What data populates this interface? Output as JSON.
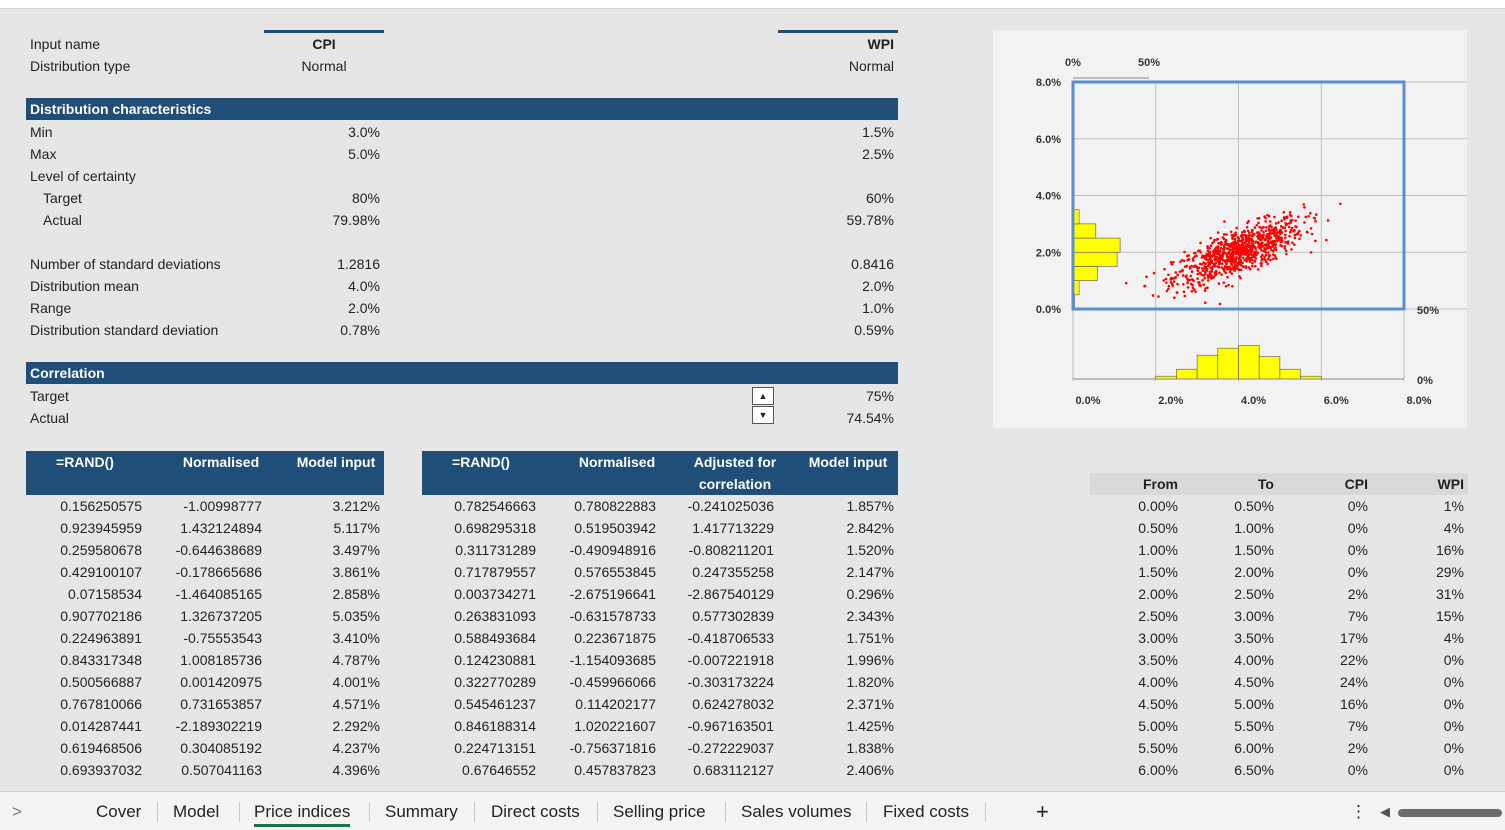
{
  "inputs": {
    "name_label": "Input name",
    "dist_type_label": "Distribution type",
    "cpi_name": "CPI",
    "wpi_name": "WPI",
    "cpi_type": "Normal",
    "wpi_type": "Normal"
  },
  "dist": {
    "header": "Distribution characteristics",
    "min_label": "Min",
    "max_label": "Max",
    "certainty_label": "Level of certainty",
    "target_label": "Target",
    "actual_label": "Actual",
    "cpi_min": "3.0%",
    "cpi_max": "5.0%",
    "cpi_target": "80%",
    "cpi_actual": "79.98%",
    "wpi_min": "1.5%",
    "wpi_max": "2.5%",
    "wpi_target": "60%",
    "wpi_actual": "59.78%",
    "nsd_label": "Number of standard deviations",
    "mean_label": "Distribution mean",
    "range_label": "Range",
    "sd_label": "Distribution standard deviation",
    "cpi_nsd": "1.2816",
    "cpi_mean": "4.0%",
    "cpi_range": "2.0%",
    "cpi_sd": "0.78%",
    "wpi_nsd": "0.8416",
    "wpi_mean": "2.0%",
    "wpi_range": "1.0%",
    "wpi_sd": "0.59%"
  },
  "correlation": {
    "header": "Correlation",
    "target_label": "Target",
    "actual_label": "Actual",
    "target": "75%",
    "actual": "74.54%",
    "spin_up": "▲",
    "spin_down": "▼"
  },
  "cpi_table": {
    "headers": [
      "=RAND()",
      "Normalised",
      "Model input"
    ],
    "rows": [
      [
        "0.156250575",
        "-1.00998777",
        "3.212%"
      ],
      [
        "0.923945959",
        "1.432124894",
        "5.117%"
      ],
      [
        "0.259580678",
        "-0.644638689",
        "3.497%"
      ],
      [
        "0.429100107",
        "-0.178665686",
        "3.861%"
      ],
      [
        "0.07158534",
        "-1.464085165",
        "2.858%"
      ],
      [
        "0.907702186",
        "1.326737205",
        "5.035%"
      ],
      [
        "0.224963891",
        "-0.75553543",
        "3.410%"
      ],
      [
        "0.843317348",
        "1.008185736",
        "4.787%"
      ],
      [
        "0.500566887",
        "0.001420975",
        "4.001%"
      ],
      [
        "0.767810066",
        "0.731653857",
        "4.571%"
      ],
      [
        "0.014287441",
        "-2.189302219",
        "2.292%"
      ],
      [
        "0.619468506",
        "0.304085192",
        "4.237%"
      ],
      [
        "0.693937032",
        "0.507041163",
        "4.396%"
      ]
    ]
  },
  "wpi_table": {
    "headers": [
      "=RAND()",
      "Normalised",
      "Adjusted for",
      "correlation",
      "Model input"
    ],
    "rows": [
      [
        "0.782546663",
        "0.780822883",
        "-0.241025036",
        "1.857%"
      ],
      [
        "0.698295318",
        "0.519503942",
        "1.417713229",
        "2.842%"
      ],
      [
        "0.311731289",
        "-0.490948916",
        "-0.808211201",
        "1.520%"
      ],
      [
        "0.717879557",
        "0.576553845",
        "0.247355258",
        "2.147%"
      ],
      [
        "0.003734271",
        "-2.675196641",
        "-2.867540129",
        "0.296%"
      ],
      [
        "0.263831093",
        "-0.631578733",
        "0.577302839",
        "2.343%"
      ],
      [
        "0.588493684",
        "0.223671875",
        "-0.418706533",
        "1.751%"
      ],
      [
        "0.124230881",
        "-1.154093685",
        "-0.007221918",
        "1.996%"
      ],
      [
        "0.322770289",
        "-0.459966066",
        "-0.303173224",
        "1.820%"
      ],
      [
        "0.545461237",
        "0.114202177",
        "0.624278032",
        "2.371%"
      ],
      [
        "0.846188314",
        "1.020221607",
        "-0.967163501",
        "1.425%"
      ],
      [
        "0.224713151",
        "-0.756371816",
        "-0.272229037",
        "1.838%"
      ],
      [
        "0.67646552",
        "0.457837823",
        "0.683112127",
        "2.406%"
      ]
    ]
  },
  "freq_table": {
    "headers": [
      "From",
      "To",
      "CPI",
      "WPI"
    ],
    "rows": [
      [
        "0.00%",
        "0.50%",
        "0%",
        "1%"
      ],
      [
        "0.50%",
        "1.00%",
        "0%",
        "4%"
      ],
      [
        "1.00%",
        "1.50%",
        "0%",
        "16%"
      ],
      [
        "1.50%",
        "2.00%",
        "0%",
        "29%"
      ],
      [
        "2.00%",
        "2.50%",
        "2%",
        "31%"
      ],
      [
        "2.50%",
        "3.00%",
        "7%",
        "15%"
      ],
      [
        "3.00%",
        "3.50%",
        "17%",
        "4%"
      ],
      [
        "3.50%",
        "4.00%",
        "22%",
        "0%"
      ],
      [
        "4.00%",
        "4.50%",
        "24%",
        "0%"
      ],
      [
        "4.50%",
        "5.00%",
        "16%",
        "0%"
      ],
      [
        "5.00%",
        "5.50%",
        "7%",
        "0%"
      ],
      [
        "5.50%",
        "6.00%",
        "2%",
        "0%"
      ],
      [
        "6.00%",
        "6.50%",
        "0%",
        "0%"
      ]
    ]
  },
  "chart_data": {
    "type": "scatter",
    "x_axis_ticks": [
      "0.0%",
      "2.0%",
      "4.0%",
      "6.0%",
      "8.0%"
    ],
    "y_axis_ticks": [
      "8.0%",
      "6.0%",
      "4.0%",
      "2.0%",
      "0.0%"
    ],
    "top_hist_ticks": [
      "0%",
      "50%"
    ],
    "right_hist_ticks": [
      "50%",
      "0%"
    ],
    "xlim": [
      0,
      8
    ],
    "ylim": [
      0,
      8
    ],
    "cpi_mean": 4.0,
    "cpi_sd": 0.78,
    "wpi_mean": 2.0,
    "wpi_sd": 0.59,
    "correlation": 0.75,
    "cpi_hist": [
      0,
      0,
      0,
      0,
      2,
      7,
      17,
      22,
      24,
      16,
      7,
      2,
      0
    ],
    "wpi_hist": [
      1,
      4,
      16,
      29,
      31,
      15,
      4,
      0,
      0,
      0,
      0,
      0,
      0
    ],
    "point_color": "#ff0000",
    "hist_color": "#ffff00",
    "box_color": "#5b8fd0"
  },
  "tabs": [
    "Cover",
    "Model",
    "Price indices",
    "Summary",
    "Direct costs",
    "Selling price",
    "Sales volumes",
    "Fixed costs"
  ],
  "tab_bar": {
    "add": "+",
    "more": "⋮",
    "nav_left": "◀",
    "sheets_arrow": ">"
  }
}
